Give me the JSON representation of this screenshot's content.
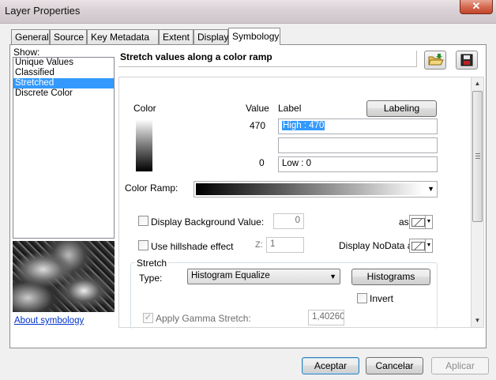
{
  "window": {
    "title": "Layer Properties",
    "close_glyph": "✕"
  },
  "tabs": [
    {
      "label": "General"
    },
    {
      "label": "Source"
    },
    {
      "label": "Key Metadata"
    },
    {
      "label": "Extent"
    },
    {
      "label": "Display"
    },
    {
      "label": "Symbology"
    }
  ],
  "active_tab": "Symbology",
  "show": {
    "label": "Show:",
    "items": [
      "Unique Values",
      "Classified",
      "Stretched",
      "Discrete Color"
    ],
    "selected": "Stretched",
    "about_link": "About symbology"
  },
  "panel": {
    "heading": "Stretch values along a color ramp",
    "icons": [
      "open-folder-icon",
      "save-icon"
    ],
    "color_header": "Color",
    "value_header": "Value",
    "label_header": "Label",
    "labeling_button": "Labeling",
    "high_value": "470",
    "high_label": "High : 470",
    "mid_label": "",
    "low_value": "0",
    "low_label": "Low : 0",
    "color_ramp_label": "Color Ramp:",
    "display_background_label": "Display Background Value:",
    "display_background_value": "0",
    "as_label": "as",
    "hillshade_label": "Use hillshade effect",
    "z_label": "Z:",
    "z_value": "1",
    "display_nodata_label": "Display NoData as",
    "stretch_group": "Stretch",
    "type_label": "Type:",
    "type_value": "Histogram Equalize",
    "histograms_button": "Histograms",
    "invert_label": "Invert",
    "gamma_label": "Apply Gamma Stretch:",
    "gamma_value": "1,40260"
  },
  "footer": {
    "ok_label": "Aceptar",
    "cancel_label": "Cancelar",
    "apply_label": "Aplicar"
  }
}
